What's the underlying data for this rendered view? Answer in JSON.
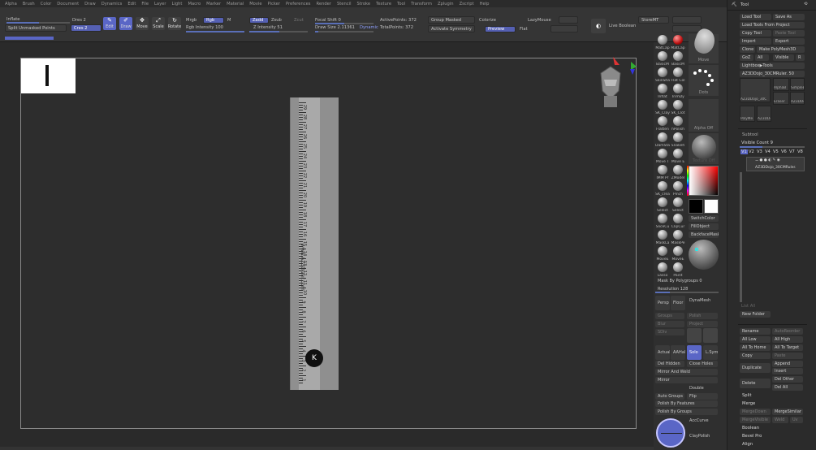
{
  "menu": [
    "Alpha",
    "Brush",
    "Color",
    "Document",
    "Draw",
    "Dynamics",
    "Edit",
    "File",
    "Layer",
    "Light",
    "Macro",
    "Marker",
    "Material",
    "Movie",
    "Picker",
    "Preferences",
    "Render",
    "Stencil",
    "Stroke",
    "Texture",
    "Tool",
    "Transform",
    "Zplugin",
    "Zscript",
    "Help"
  ],
  "shelf": {
    "inflate_label": "Inflate",
    "split_unmasked": "Split Unmasked Points",
    "dres": "Dres 2",
    "cres": "Cres 2",
    "edit": "Edit",
    "draw": "Draw",
    "move": "Move",
    "scale": "Scale",
    "rotate": "Rotate",
    "mrgb": "Mrgb",
    "rgb": "Rgb",
    "m": "M",
    "rgb_intensity": "Rgb Intensity 100",
    "zadd": "Zadd",
    "zsub": "Zsub",
    "zcut": "Zcut",
    "z_intensity": "Z Intensity 51",
    "focal_shift": "Focal Shift 0",
    "draw_size": "Draw Size 2.11361",
    "dynamic": "Dynamic",
    "active_points": "ActivePoints: 372",
    "total_points": "TotalPoints: 372",
    "group_masked": "Group Masked",
    "colorize": "Colorize",
    "lazymouse": "LazyMouse",
    "activate_symmetry": "Activate Symmetry",
    "preview": "Preview",
    "flat": "Flat",
    "live_boolean": "Live Boolean",
    "storemt": "StoreMT"
  },
  "viewport": {
    "ruler_url": "www.AZ3Dizer.com",
    "ruler_numbers": [
      "1",
      "2",
      "3",
      "4",
      "5",
      "6",
      "7",
      "8",
      "9",
      "10",
      "11",
      "12",
      "13",
      "14",
      "15",
      "16",
      "17",
      "18",
      "19",
      "20",
      "21",
      "22",
      "23",
      "24",
      "25",
      "26",
      "27",
      "28",
      "29"
    ],
    "badge_letter": "K"
  },
  "toolcol": {
    "brushes": [
      [
        "MatCap",
        "MatCap"
      ],
      [
        "BasicM",
        "BasicM"
      ],
      [
        "SkinSha",
        "Flat Col"
      ],
      [
        "Inflat",
        "TrimDy"
      ],
      [
        "SK_Clay",
        "SK_Clot"
      ],
      [
        "Flatten",
        "hPolish"
      ],
      [
        "DamSta",
        "Snakeh"
      ],
      [
        "Move T",
        "Move E"
      ],
      [
        "IMM Pr",
        "ZModel"
      ],
      [
        "SK_crea",
        "Pinch"
      ],
      [
        "Select",
        "Select"
      ],
      [
        "SliceCu",
        "ClipCur"
      ],
      [
        "MaskLa",
        "MaskPe"
      ],
      [
        "MoveE",
        "MoveE"
      ],
      [
        "Lasso",
        "Paint"
      ]
    ],
    "move": "Move",
    "dots": "Dots",
    "alpha_off": "Alpha Off",
    "texture_off": "Texture Off",
    "switch_color": "SwitchColor",
    "fill_object": "FillObject",
    "backface_mask": "BackfaceMask",
    "mask_by_polygroups": "Mask By Polygroups 0",
    "resolution": "Resolution 128",
    "persp": "Persp",
    "floor": "Floor",
    "dynamesh": "DynaMesh",
    "groups": "Groups",
    "polish": "Polish",
    "blur": "Blur",
    "project": "Project",
    "sdiv": "SDiv",
    "actual": "Actual",
    "aahalf": "AAHalf",
    "solo": "Solo",
    "lsym": "L.Sym",
    "del_hidden": "Del Hidden",
    "close_holes": "Close Holes",
    "mirror_and_weld": "Mirror And Weld",
    "mirror": "Mirror",
    "double": "Double",
    "auto_groups": "Auto Groups",
    "flip": "Flip",
    "polish_by_features": "Polish By Features",
    "polish_by_groups": "Polish By Groups",
    "accurve": "AccCurve",
    "claypolish": "ClayPolish"
  },
  "palette": {
    "title": "Tool",
    "load_tool": "Load Tool",
    "save_as": "Save As",
    "load_tools_from_project": "Load Tools From Project",
    "copy_tool": "Copy Tool",
    "paste_tool": "Paste Tool",
    "import": "Import",
    "export": "Export",
    "clone": "Clone",
    "make_polymesh": "Make PolyMesh3D",
    "goz": "GoZ",
    "all": "All",
    "visible": "Visible",
    "r": "R",
    "lightbox_tools": "Lightbox▶Tools",
    "current_tool": "AZ3DDojo_30CMRuler. 50",
    "thumbs": [
      "AZ3DDojo_30C",
      "AlphaB",
      "SimpleB",
      "Eraser",
      "AZ3DDo",
      "PolyMe",
      "AZ3DDo"
    ],
    "subtool": "Subtool",
    "visible_count": "Visible Count 9",
    "versions": [
      "V1",
      "V2",
      "V3",
      "V4",
      "V5",
      "V6",
      "V7",
      "V8"
    ],
    "subtool_item": "AZ3DDojo_30CMRuler.",
    "list_all": "List All",
    "new_folder": "New Folder",
    "rename": "Rename",
    "autoreorder": "AutoReorder",
    "all_low": "All Low",
    "all_high": "All High",
    "all_to_home": "All To Home",
    "all_to_target": "All To Target",
    "copy": "Copy",
    "paste": "Paste",
    "duplicate": "Duplicate",
    "append": "Append",
    "insert": "Insert",
    "delete": "Delete",
    "del_other": "Del Other",
    "del_all": "Del All",
    "split": "Split",
    "merge": "Merge",
    "merge_down": "MergeDown",
    "merge_similar": "MergeSimilar",
    "merge_visible": "MergeVisible",
    "weld": "Weld",
    "uv": "Uv",
    "boolean": "Boolean",
    "bevel_pro": "Bevel Pro",
    "align": "Align"
  },
  "colors": {
    "accent": "#5a66c6",
    "background": "#262626",
    "panel": "#2b2b2b"
  }
}
